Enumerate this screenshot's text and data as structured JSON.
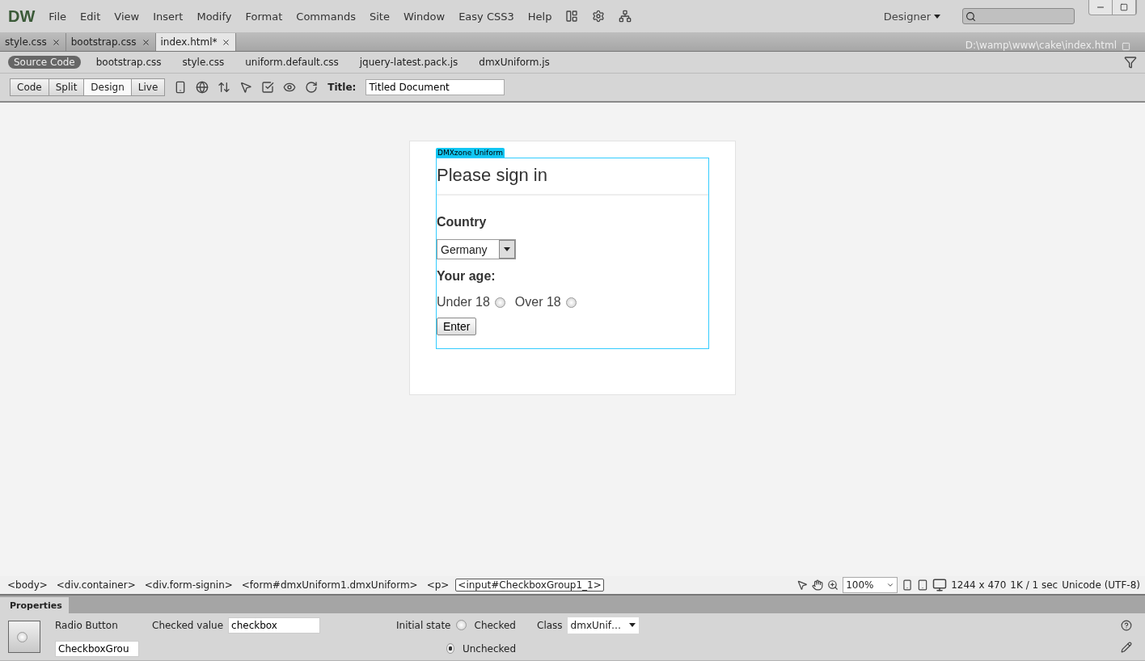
{
  "menubar": {
    "logo": "DW",
    "items": [
      "File",
      "Edit",
      "View",
      "Insert",
      "Modify",
      "Format",
      "Commands",
      "Site",
      "Window",
      "Easy CSS3",
      "Help"
    ],
    "workspace": "Designer"
  },
  "tabs": [
    {
      "label": "style.css",
      "selected": false
    },
    {
      "label": "bootstrap.css",
      "selected": false
    },
    {
      "label": "index.html*",
      "selected": true
    }
  ],
  "file_path": "D:\\wamp\\www\\cake\\index.html",
  "related_files": [
    {
      "label": "Source Code",
      "selected": true
    },
    {
      "label": "bootstrap.css",
      "selected": false
    },
    {
      "label": "style.css",
      "selected": false
    },
    {
      "label": "uniform.default.css",
      "selected": false
    },
    {
      "label": "jquery-latest.pack.js",
      "selected": false
    },
    {
      "label": "dmxUniform.js",
      "selected": false
    }
  ],
  "view_buttons": [
    {
      "label": "Code",
      "selected": false
    },
    {
      "label": "Split",
      "selected": false
    },
    {
      "label": "Design",
      "selected": true
    },
    {
      "label": "Live",
      "selected": false
    }
  ],
  "title_label": "Title:",
  "title_value": "Titled Document",
  "design": {
    "badge": "DMXzone Uniform",
    "heading": "Please sign in",
    "country_label": "Country",
    "country_value": "Germany",
    "age_label": "Your age:",
    "radios": [
      {
        "label": "Under 18",
        "checked": false
      },
      {
        "label": "Over 18",
        "checked": false
      }
    ],
    "submit": "Enter"
  },
  "tag_selector": [
    {
      "label": "<body>",
      "selected": false
    },
    {
      "label": "<div.container>",
      "selected": false
    },
    {
      "label": "<div.form-signin>",
      "selected": false
    },
    {
      "label": "<form#dmxUniform1.dmxUniform>",
      "selected": false
    },
    {
      "label": "<p>",
      "selected": false
    },
    {
      "label": "<input#CheckboxGroup1_1>",
      "selected": true
    }
  ],
  "status": {
    "zoom": "100%",
    "size": "1244 x 470",
    "download": "1K / 1 sec",
    "encoding": "Unicode (UTF-8)"
  },
  "properties": {
    "title": "Properties",
    "element_type": "Radio Button",
    "name_value": "CheckboxGrou",
    "checked_value_label": "Checked value",
    "checked_value": "checkbox",
    "initial_state_label": "Initial state",
    "states": [
      {
        "label": "Checked",
        "selected": false
      },
      {
        "label": "Unchecked",
        "selected": true
      }
    ],
    "class_label": "Class",
    "class_value": "dmxUnif…"
  }
}
